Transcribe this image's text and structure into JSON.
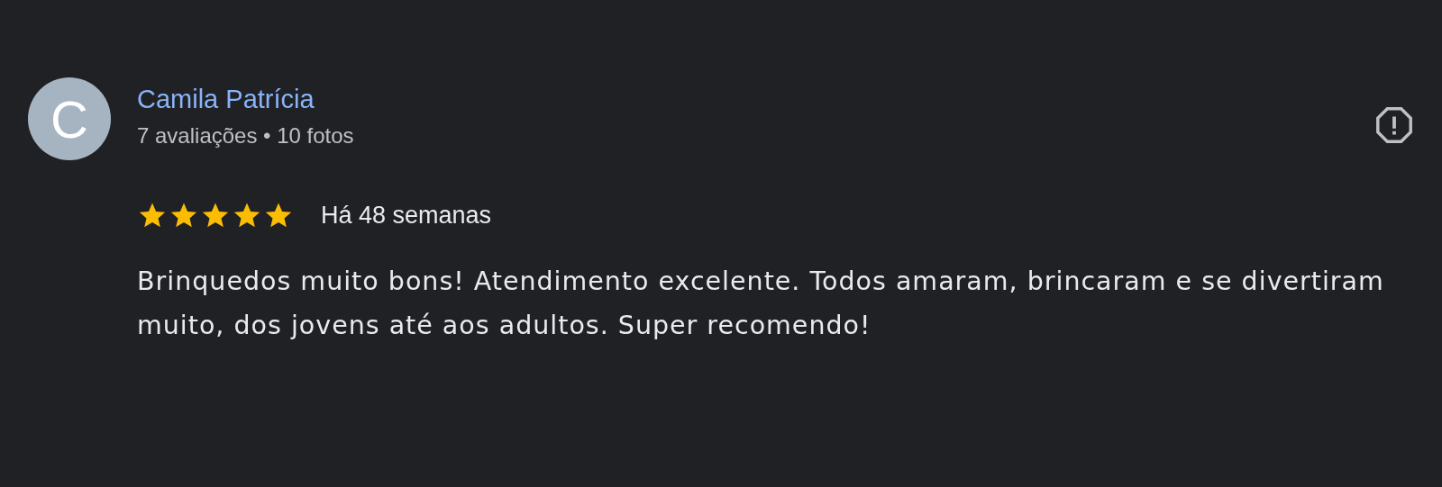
{
  "review": {
    "author": "Camila Patrícia",
    "avatar_letter": "C",
    "author_stats": "7 avaliações • 10 fotos",
    "stars": 5,
    "time": "Há 48 semanas",
    "text": "Brinquedos muito bons! Atendimento excelente. Todos amaram, brincaram e se divertiram muito, dos jovens até aos adultos. Super recomendo!"
  }
}
